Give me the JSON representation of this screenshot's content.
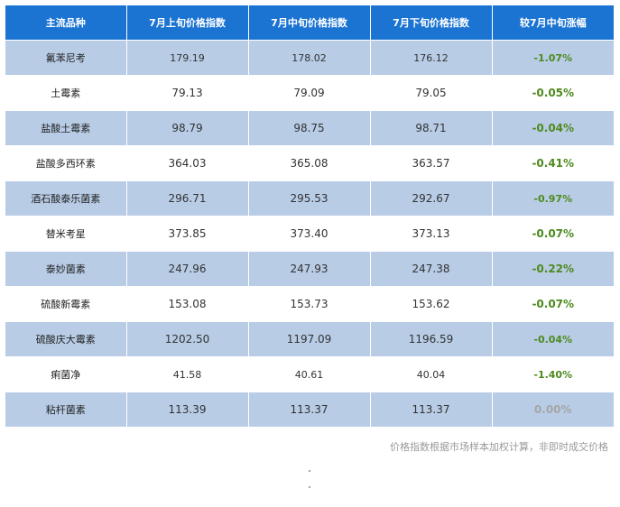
{
  "table": {
    "headers": [
      "主流品种",
      "7月上旬价格指数",
      "7月中旬价格指数",
      "7月下旬价格指数",
      "较7月中旬涨幅"
    ],
    "rows": [
      {
        "name": "氟苯尼考",
        "early": "179.19",
        "mid": "178.02",
        "late": "176.12",
        "change": "-1.07%"
      },
      {
        "name": "土霉素",
        "early": "79.13",
        "mid": "79.09",
        "late": "79.05",
        "change": "-0.05%"
      },
      {
        "name": "盐酸土霉素",
        "early": "98.79",
        "mid": "98.75",
        "late": "98.71",
        "change": "-0.04%"
      },
      {
        "name": "盐酸多西环素",
        "early": "364.03",
        "mid": "365.08",
        "late": "363.57",
        "change": "-0.41%"
      },
      {
        "name": "酒石酸泰乐菌素",
        "early": "296.71",
        "mid": "295.53",
        "late": "292.67",
        "change": "-0.97%"
      },
      {
        "name": "替米考星",
        "early": "373.85",
        "mid": "373.40",
        "late": "373.13",
        "change": "-0.07%"
      },
      {
        "name": "泰妙菌素",
        "early": "247.96",
        "mid": "247.93",
        "late": "247.38",
        "change": "-0.22%"
      },
      {
        "name": "硫酸新霉素",
        "early": "153.08",
        "mid": "153.73",
        "late": "153.62",
        "change": "-0.07%"
      },
      {
        "name": "硫酸庆大霉素",
        "early": "1202.50",
        "mid": "1197.09",
        "late": "1196.59",
        "change": "-0.04%"
      },
      {
        "name": "痢菌净",
        "early": "41.58",
        "mid": "40.61",
        "late": "40.04",
        "change": "-1.40%"
      },
      {
        "name": "粘杆菌素",
        "early": "113.39",
        "mid": "113.37",
        "late": "113.37",
        "change": "0.00%"
      }
    ]
  },
  "footnote": "价格指数根据市场样本加权计算，非即时成交价格",
  "colors": {
    "header_bg": "#1b74d2",
    "stripe_bg": "#b8cce6",
    "change_text": "#4e8a1e",
    "zero_change_text": "#a6a6a6"
  }
}
